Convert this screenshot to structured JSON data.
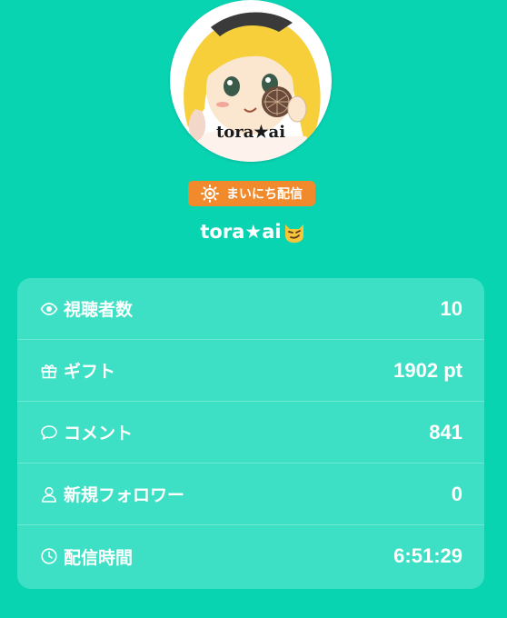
{
  "profile": {
    "avatar_caption": "tora★ai",
    "badge_label": "まいにち配信",
    "badge_icon": "sun-icon",
    "username": "tora★ai",
    "username_emoji": "smirking-cat-emoji"
  },
  "colors": {
    "background": "#09d4b2",
    "card": "#3de0c4",
    "badge": "#f08a2c",
    "text": "#ffffff"
  },
  "stats": [
    {
      "icon": "eye-icon",
      "label": "視聴者数",
      "value": "10"
    },
    {
      "icon": "gift-icon",
      "label": "ギフト",
      "value": "1902 pt"
    },
    {
      "icon": "comment-icon",
      "label": "コメント",
      "value": "841"
    },
    {
      "icon": "person-icon",
      "label": "新規フォロワー",
      "value": "0"
    },
    {
      "icon": "clock-icon",
      "label": "配信時間",
      "value": "6:51:29"
    }
  ]
}
